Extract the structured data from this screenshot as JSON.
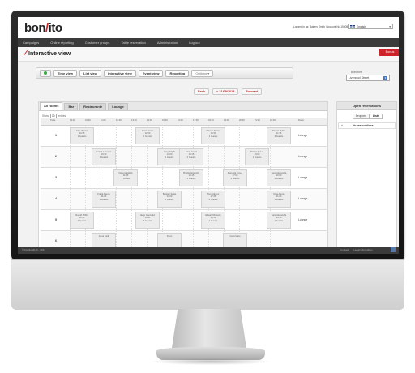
{
  "app": {
    "logo_left": "bon",
    "logo_slash": "/",
    "logo_right": "ito",
    "logged_in_text": "Logged in as: Bakery Smith (Account Nr. 150087897)",
    "language": "English"
  },
  "topnav": [
    "Campaigns",
    "Online reporting",
    "Customer groups",
    "Table reservation",
    "Administration",
    "Log out"
  ],
  "page": {
    "title": "Interactive view",
    "corner_button": "Bonus"
  },
  "toolbar": {
    "buttons": [
      "Time view",
      "List view",
      "Interactive view",
      "Event view",
      "Reporting"
    ],
    "options": "Options"
  },
  "branch": {
    "label": "Branches",
    "value": "Liverpool Street"
  },
  "date_nav": {
    "back": "Back",
    "date": "< 21/09/2013",
    "forward": "Forward"
  },
  "room_tabs": [
    "All rooms",
    "Bar",
    "Restaurante",
    "Lounge"
  ],
  "show_entries": {
    "prefix": "Show",
    "value": "10",
    "suffix": "entries"
  },
  "grid_header": {
    "first": "Table",
    "times": [
      "09:00",
      "10:00",
      "11:00",
      "12:00",
      "13:00",
      "14:00",
      "15:00",
      "16:00",
      "17:00",
      "18:00",
      "19:00",
      "20:00",
      "21:00",
      "22:00"
    ],
    "last": "Room"
  },
  "rows": [
    {
      "num": "1",
      "room": "Lounge",
      "reservations": [
        {
          "name": "Jake Weeks",
          "time": "10:15",
          "guests": "1 Guests"
        },
        {
          "name": "Anita Torres",
          "time": "12:00",
          "guests": "1 Guests"
        },
        {
          "name": "Marcos Torres",
          "time": "16:30",
          "guests": "1 Guests"
        },
        {
          "name": "Pascal Muller",
          "time": "21:15",
          "guests": "3 Guests"
        }
      ]
    },
    {
      "num": "2",
      "room": "Lounge",
      "reservations": [
        {
          "name": "Frank Lamond",
          "time": "10:30",
          "guests": "1 Guests"
        },
        {
          "name": "Gary Wright",
          "time": "13:00",
          "guests": "1 Guests"
        },
        {
          "name": "Dario Costa",
          "time": "15:15",
          "guests": "1 Guests"
        },
        {
          "name": "Martha Flores",
          "time": "19:00",
          "guests": "1 Guests"
        }
      ]
    },
    {
      "num": "3",
      "room": "Lounge",
      "reservations": [
        {
          "name": "Dave Maldock",
          "time": "11:45",
          "guests": "1 Guests"
        },
        {
          "name": "Brigitte Eisebeth",
          "time": "15:15",
          "guests": "4 Guests"
        },
        {
          "name": "Manuela Jones",
          "time": "17:00",
          "guests": "2 Guests"
        },
        {
          "name": "Jane Alexandra",
          "time": "20:00",
          "guests": "2 Guests"
        }
      ]
    },
    {
      "num": "4",
      "room": "Lounge",
      "reservations": [
        {
          "name": "Frank Aikens",
          "time": "11:00",
          "guests": "1 Guests"
        },
        {
          "name": "Bastien Salas",
          "time": "13:00",
          "guests": "1 Guests"
        },
        {
          "name": "Tony Aikens",
          "time": "17:45",
          "guests": "1 Guests"
        },
        {
          "name": "Nina Alexis",
          "time": "21:00",
          "guests": "1 Guests"
        }
      ]
    },
    {
      "num": "5",
      "room": "Lounge",
      "reservations": [
        {
          "name": "Rudolf Pfiffer",
          "time": "10:30",
          "guests": "1 Guests"
        },
        {
          "name": "Hugo Gonzalez",
          "time": "13:15",
          "guests": "6 Guests"
        },
        {
          "name": "Edward Roberts",
          "time": "16:30",
          "guests": "1 Guests"
        },
        {
          "name": "Sara Alexandra",
          "time": "20:15",
          "guests": "1 Guests"
        }
      ]
    },
    {
      "num": "6",
      "room": "",
      "reservations": [
        {
          "name": "Anna Kadi",
          "time": "",
          "guests": ""
        },
        {
          "name": "Dario",
          "time": "",
          "guests": ""
        },
        {
          "name": "Carol Mare",
          "time": "",
          "guests": ""
        }
      ]
    }
  ],
  "open_reservations": {
    "title": "Open reservations",
    "toggle": [
      "Dropped",
      "Lists"
    ],
    "empty_text": "No reservations",
    "expand_symbol": "+"
  },
  "footer": {
    "copyright": "© bon/ito 2010 - 2013",
    "links": [
      "Contact",
      "Legal information"
    ]
  }
}
